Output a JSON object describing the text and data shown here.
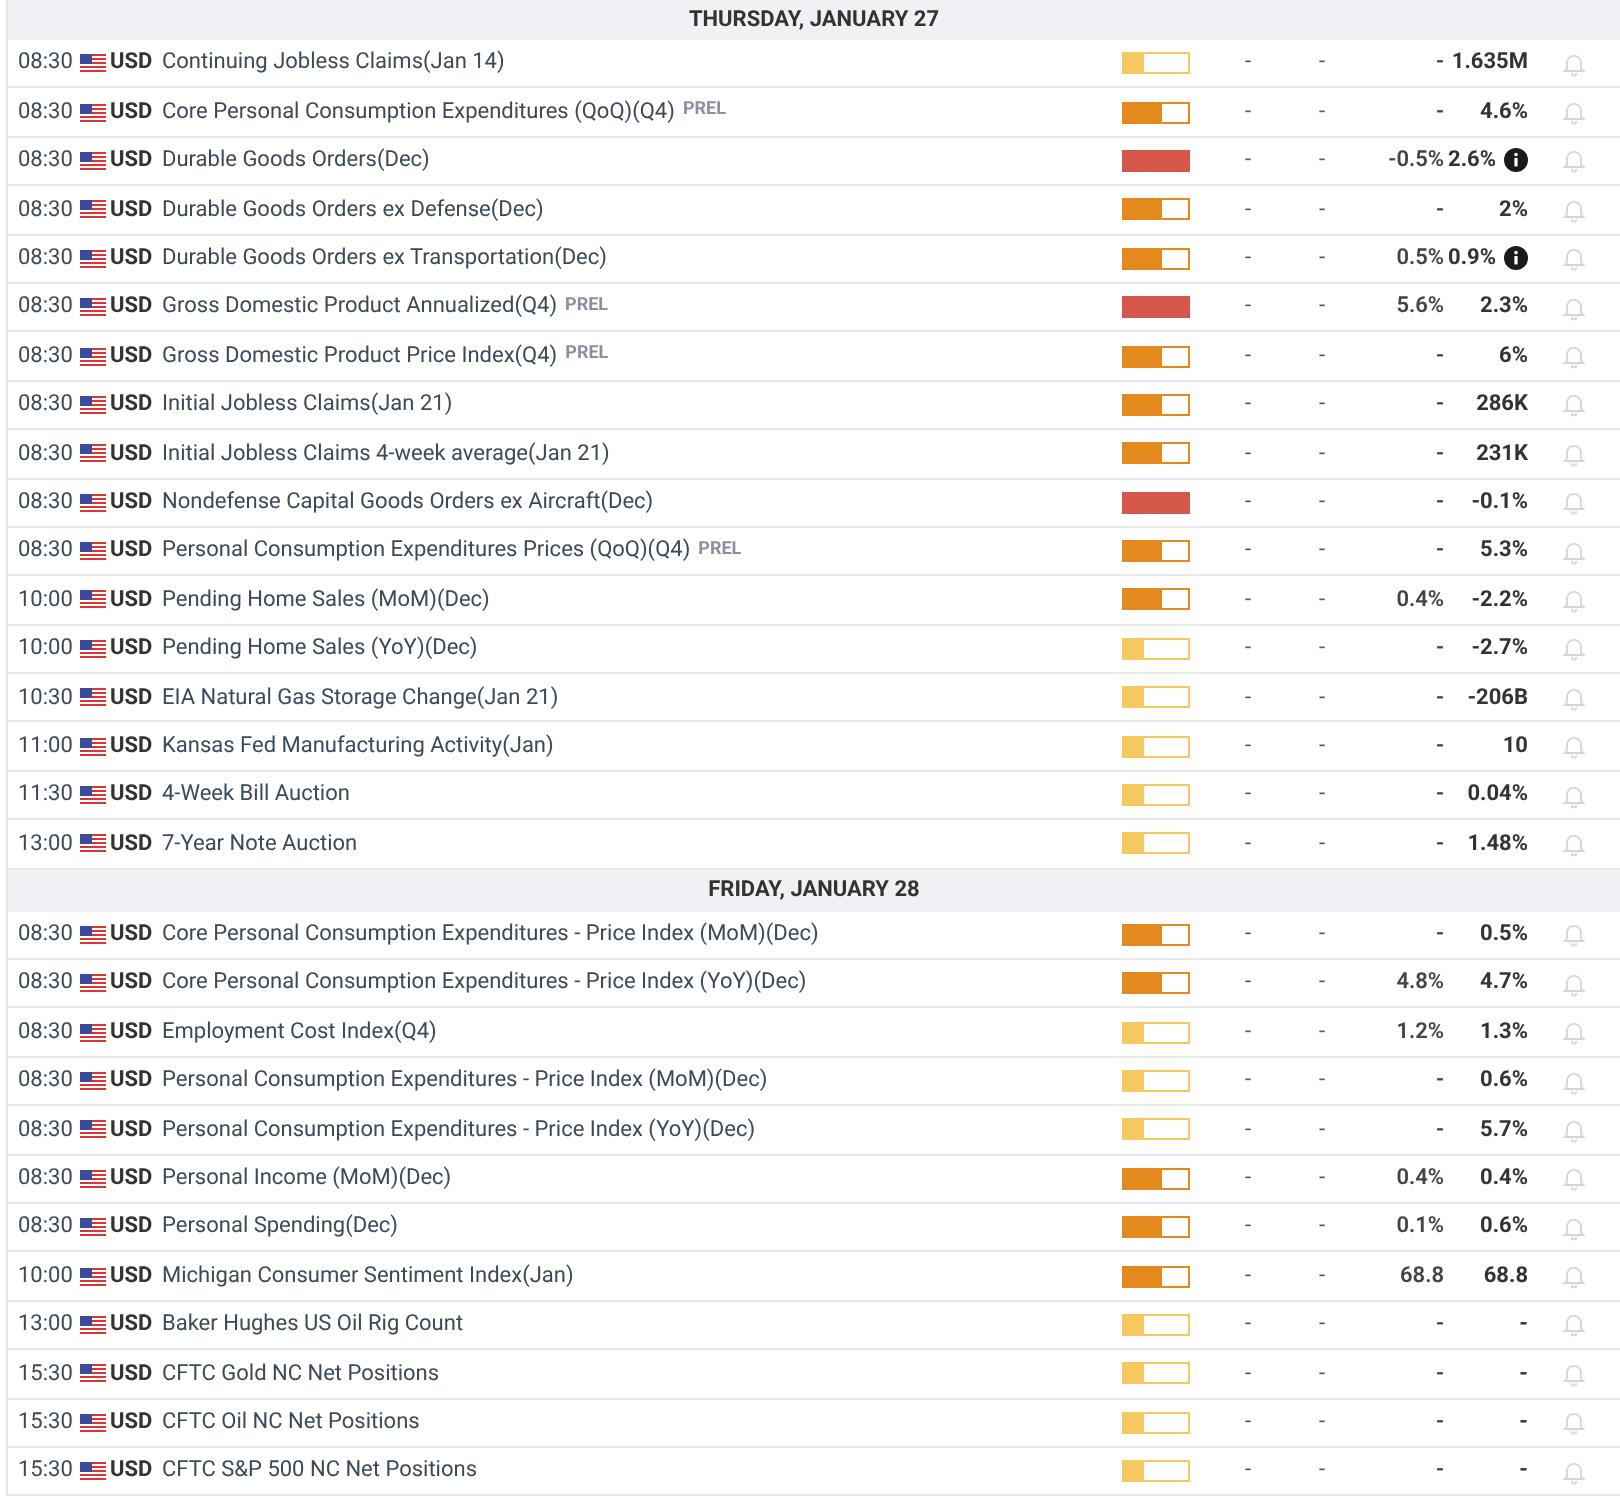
{
  "days": [
    {
      "title": "THURSDAY, JANUARY 27",
      "events": [
        {
          "time": "08:30",
          "currency": "USD",
          "name": "Continuing Jobless Claims(Jan 14)",
          "level": 0.3,
          "color": "#f6c860",
          "values": [
            "-",
            "-",
            "-",
            "1.635M"
          ],
          "note": false
        },
        {
          "time": "08:30",
          "currency": "USD",
          "name": "Core Personal Consumption Expenditures (QoQ)(Q4)",
          "tag": "PREL",
          "level": 0.6,
          "color": "#e3891e",
          "values": [
            "-",
            "-",
            "-",
            "4.6%"
          ],
          "note": false
        },
        {
          "time": "08:30",
          "currency": "USD",
          "name": "Durable Goods Orders(Dec)",
          "level": 1,
          "color": "#d5574a",
          "values": [
            "-",
            "-",
            "-0.5%",
            "2.6%"
          ],
          "note": true
        },
        {
          "time": "08:30",
          "currency": "USD",
          "name": "Durable Goods Orders ex Defense(Dec)",
          "level": 0.6,
          "color": "#e3891e",
          "values": [
            "-",
            "-",
            "-",
            "2%"
          ],
          "note": false
        },
        {
          "time": "08:30",
          "currency": "USD",
          "name": "Durable Goods Orders ex Transportation(Dec)",
          "level": 0.6,
          "color": "#e3891e",
          "values": [
            "-",
            "-",
            "0.5%",
            "0.9%"
          ],
          "note": true
        },
        {
          "time": "08:30",
          "currency": "USD",
          "name": "Gross Domestic Product Annualized(Q4)",
          "tag": "PREL",
          "level": 1,
          "color": "#d5574a",
          "values": [
            "-",
            "-",
            "5.6%",
            "2.3%"
          ],
          "note": false
        },
        {
          "time": "08:30",
          "currency": "USD",
          "name": "Gross Domestic Product Price Index(Q4)",
          "tag": "PREL",
          "level": 0.6,
          "color": "#e3891e",
          "values": [
            "-",
            "-",
            "-",
            "6%"
          ],
          "note": false
        },
        {
          "time": "08:30",
          "currency": "USD",
          "name": "Initial Jobless Claims(Jan 21)",
          "level": 0.6,
          "color": "#e3891e",
          "values": [
            "-",
            "-",
            "-",
            "286K"
          ],
          "note": false
        },
        {
          "time": "08:30",
          "currency": "USD",
          "name": "Initial Jobless Claims 4-week average(Jan 21)",
          "level": 0.6,
          "color": "#e3891e",
          "values": [
            "-",
            "-",
            "-",
            "231K"
          ],
          "note": false
        },
        {
          "time": "08:30",
          "currency": "USD",
          "name": "Nondefense Capital Goods Orders ex Aircraft(Dec)",
          "level": 1,
          "color": "#d5574a",
          "values": [
            "-",
            "-",
            "-",
            "-0.1%"
          ],
          "note": false
        },
        {
          "time": "08:30",
          "currency": "USD",
          "name": "Personal Consumption Expenditures Prices (QoQ)(Q4)",
          "tag": "PREL",
          "level": 0.6,
          "color": "#e3891e",
          "values": [
            "-",
            "-",
            "-",
            "5.3%"
          ],
          "note": false
        },
        {
          "time": "10:00",
          "currency": "USD",
          "name": "Pending Home Sales (MoM)(Dec)",
          "level": 0.6,
          "color": "#e3891e",
          "values": [
            "-",
            "-",
            "0.4%",
            "-2.2%"
          ],
          "note": false
        },
        {
          "time": "10:00",
          "currency": "USD",
          "name": "Pending Home Sales (YoY)(Dec)",
          "level": 0.3,
          "color": "#f6c860",
          "values": [
            "-",
            "-",
            "-",
            "-2.7%"
          ],
          "note": false
        },
        {
          "time": "10:30",
          "currency": "USD",
          "name": "EIA Natural Gas Storage Change(Jan 21)",
          "level": 0.3,
          "color": "#f6c860",
          "values": [
            "-",
            "-",
            "-",
            "-206B"
          ],
          "note": false
        },
        {
          "time": "11:00",
          "currency": "USD",
          "name": "Kansas Fed Manufacturing Activity(Jan)",
          "level": 0.3,
          "color": "#f6c860",
          "values": [
            "-",
            "-",
            "-",
            "10"
          ],
          "note": false
        },
        {
          "time": "11:30",
          "currency": "USD",
          "name": "4-Week Bill Auction",
          "level": 0.3,
          "color": "#f6c860",
          "values": [
            "-",
            "-",
            "-",
            "0.04%"
          ],
          "note": false
        },
        {
          "time": "13:00",
          "currency": "USD",
          "name": "7-Year Note Auction",
          "level": 0.3,
          "color": "#f6c860",
          "values": [
            "-",
            "-",
            "-",
            "1.48%"
          ],
          "note": false
        }
      ]
    },
    {
      "title": "FRIDAY, JANUARY 28",
      "events": [
        {
          "time": "08:30",
          "currency": "USD",
          "name": "Core Personal Consumption Expenditures - Price Index (MoM)(Dec)",
          "level": 0.6,
          "color": "#e3891e",
          "values": [
            "-",
            "-",
            "-",
            "0.5%"
          ],
          "note": false
        },
        {
          "time": "08:30",
          "currency": "USD",
          "name": "Core Personal Consumption Expenditures - Price Index (YoY)(Dec)",
          "level": 0.6,
          "color": "#e3891e",
          "values": [
            "-",
            "-",
            "4.8%",
            "4.7%"
          ],
          "note": false
        },
        {
          "time": "08:30",
          "currency": "USD",
          "name": "Employment Cost Index(Q4)",
          "level": 0.3,
          "color": "#f6c860",
          "values": [
            "-",
            "-",
            "1.2%",
            "1.3%"
          ],
          "note": false
        },
        {
          "time": "08:30",
          "currency": "USD",
          "name": "Personal Consumption Expenditures - Price Index (MoM)(Dec)",
          "level": 0.3,
          "color": "#f6c860",
          "values": [
            "-",
            "-",
            "-",
            "0.6%"
          ],
          "note": false
        },
        {
          "time": "08:30",
          "currency": "USD",
          "name": "Personal Consumption Expenditures - Price Index (YoY)(Dec)",
          "level": 0.3,
          "color": "#f6c860",
          "values": [
            "-",
            "-",
            "-",
            "5.7%"
          ],
          "note": false
        },
        {
          "time": "08:30",
          "currency": "USD",
          "name": "Personal Income (MoM)(Dec)",
          "level": 0.6,
          "color": "#e3891e",
          "values": [
            "-",
            "-",
            "0.4%",
            "0.4%"
          ],
          "note": false
        },
        {
          "time": "08:30",
          "currency": "USD",
          "name": "Personal Spending(Dec)",
          "level": 0.6,
          "color": "#e3891e",
          "values": [
            "-",
            "-",
            "0.1%",
            "0.6%"
          ],
          "note": false
        },
        {
          "time": "10:00",
          "currency": "USD",
          "name": "Michigan Consumer Sentiment Index(Jan)",
          "level": 0.6,
          "color": "#e3891e",
          "values": [
            "-",
            "-",
            "68.8",
            "68.8"
          ],
          "note": false
        },
        {
          "time": "13:00",
          "currency": "USD",
          "name": "Baker Hughes US Oil Rig Count",
          "level": 0.3,
          "color": "#f6c860",
          "values": [
            "-",
            "-",
            "-",
            "-"
          ],
          "note": false
        },
        {
          "time": "15:30",
          "currency": "USD",
          "name": "CFTC Gold NC Net Positions",
          "level": 0.3,
          "color": "#f6c860",
          "values": [
            "-",
            "-",
            "-",
            "-"
          ],
          "note": false
        },
        {
          "time": "15:30",
          "currency": "USD",
          "name": "CFTC Oil NC Net Positions",
          "level": 0.3,
          "color": "#f6c860",
          "values": [
            "-",
            "-",
            "-",
            "-"
          ],
          "note": false
        },
        {
          "time": "15:30",
          "currency": "USD",
          "name": "CFTC S&P 500 NC Net Positions",
          "level": 0.3,
          "color": "#f6c860",
          "values": [
            "-",
            "-",
            "-",
            "-"
          ],
          "note": false
        }
      ]
    }
  ]
}
